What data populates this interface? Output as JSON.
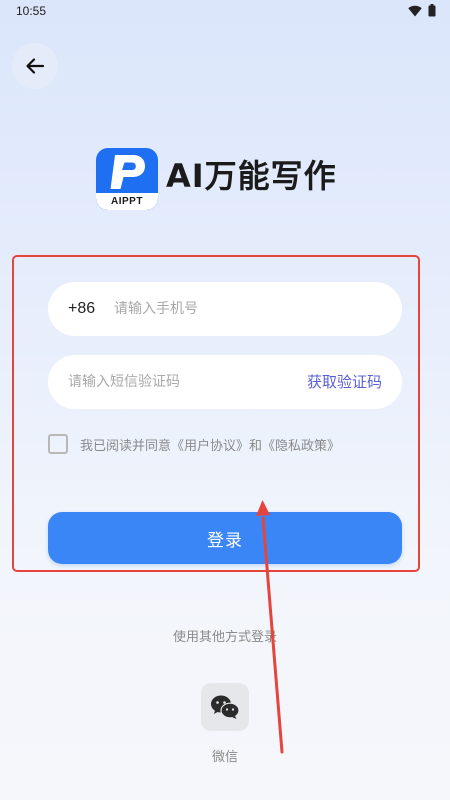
{
  "status_bar": {
    "time": "10:55"
  },
  "header": {
    "back_icon": "arrow-left-icon"
  },
  "brand": {
    "logo_letter_icon": "p-logo-icon",
    "logo_sub": "AIPPT",
    "title": "AI万能写作",
    "logo_color": "#1f6ff2"
  },
  "form": {
    "country_code": "+86",
    "phone_placeholder": "请输入手机号",
    "phone_value": "",
    "sms_placeholder": "请输入短信验证码",
    "sms_value": "",
    "get_code_label": "获取验证码",
    "agreement_text": "我已阅读并同意《用户协议》和《隐私政策》",
    "agreement_checked": false,
    "login_label": "登录",
    "accent_color": "#3a86f7"
  },
  "other_login": {
    "label": "使用其他方式登录",
    "wechat_label": "微信",
    "wechat_icon": "wechat-icon"
  },
  "annotation": {
    "color": "#e5453c"
  }
}
